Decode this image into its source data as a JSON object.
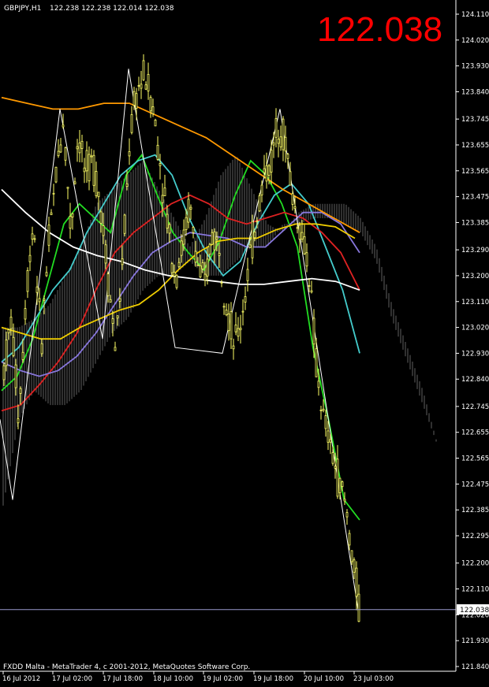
{
  "header": {
    "symbol_label": "GBPJPY,H1",
    "ohlc_label": "122.238 122.238 122.014 122.038",
    "big_price": "122.038"
  },
  "footer": {
    "copyright": "FXDD Malta - MetaTrader 4, c 2001-2012, MetaQuotes Software Corp."
  },
  "chart_data": {
    "type": "line",
    "symbol": "GBPJPY",
    "timeframe": "H1",
    "current_price": 122.038,
    "current_price_label": "122.038",
    "ylim": [
      121.84,
      124.11
    ],
    "y_ticks": [
      "124.110",
      "124.020",
      "123.930",
      "123.840",
      "123.745",
      "123.655",
      "123.565",
      "123.475",
      "123.385",
      "123.290",
      "123.200",
      "123.110",
      "123.020",
      "122.930",
      "122.840",
      "122.745",
      "122.655",
      "122.565",
      "122.475",
      "122.385",
      "122.295",
      "122.200",
      "122.110",
      "122.020",
      "121.930",
      "121.840"
    ],
    "x_ticks": [
      "16 Jul 2012",
      "17 Jul 02:00",
      "17 Jul 18:00",
      "18 Jul 10:00",
      "19 Jul 02:00",
      "19 Jul 18:00",
      "20 Jul 10:00",
      "23 Jul 03:00"
    ],
    "colors": {
      "background": "#000000",
      "axis": "#ffffff",
      "price": "#ffff66",
      "zigzag": "#ffffff",
      "ma_fast": "#22dd22",
      "ma_cyan": "#44cccc",
      "ma_red": "#dd2222",
      "ma_purple": "#8877dd",
      "ma_yellow": "#eecc00",
      "ma_orange": "#ff9900",
      "ma_white": "#ffffff",
      "current_line": "#9999cc",
      "big_price": "#ff0000"
    },
    "price_path": [
      122.88,
      123.05,
      122.7,
      123.15,
      123.4,
      122.95,
      123.3,
      123.55,
      123.75,
      123.35,
      123.7,
      123.55,
      123.6,
      123.45,
      123.2,
      122.95,
      123.25,
      123.7,
      123.85,
      123.9,
      123.8,
      123.6,
      123.4,
      123.2,
      123.3,
      123.45,
      123.25,
      123.15,
      123.35,
      123.3,
      123.1,
      122.95,
      123.05,
      123.25,
      123.4,
      123.55,
      123.6,
      123.75,
      123.65,
      123.45,
      123.35,
      123.25,
      122.9,
      122.7,
      122.6,
      122.5,
      122.4,
      122.2,
      122.02
    ],
    "zigzag": [
      [
        0,
        122.7
      ],
      [
        16,
        122.42
      ],
      [
        76,
        123.78
      ],
      [
        130,
        122.98
      ],
      [
        163,
        123.92
      ],
      [
        222,
        122.95
      ],
      [
        282,
        122.93
      ],
      [
        355,
        123.78
      ],
      [
        455,
        122.02
      ]
    ],
    "series": [
      {
        "name": "",
        "color_key": "ma_fast",
        "values": [
          122.8,
          122.85,
          122.98,
          123.18,
          123.38,
          123.45,
          123.4,
          123.35,
          123.55,
          123.62,
          123.48,
          123.35,
          123.28,
          123.22,
          123.32,
          123.48,
          123.6,
          123.55,
          123.45,
          123.3,
          122.95,
          122.7,
          122.42,
          122.35
        ]
      },
      {
        "name": "",
        "color_key": "ma_cyan",
        "values": [
          122.9,
          122.95,
          123.05,
          123.15,
          123.22,
          123.35,
          123.45,
          123.55,
          123.6,
          123.62,
          123.55,
          123.4,
          123.28,
          123.2,
          123.25,
          123.38,
          123.48,
          123.52,
          123.45,
          123.3,
          123.15,
          122.93
        ]
      },
      {
        "name": "",
        "color_key": "ma_red",
        "values": [
          122.73,
          122.75,
          122.82,
          122.9,
          123.0,
          123.15,
          123.28,
          123.35,
          123.4,
          123.45,
          123.48,
          123.45,
          123.4,
          123.38,
          123.4,
          123.42,
          123.4,
          123.35,
          123.28,
          123.15
        ]
      },
      {
        "name": "",
        "color_key": "ma_purple",
        "values": [
          122.9,
          122.87,
          122.85,
          122.87,
          122.92,
          123.0,
          123.1,
          123.2,
          123.28,
          123.32,
          123.35,
          123.34,
          123.33,
          123.3,
          123.3,
          123.36,
          123.42,
          123.42,
          123.38,
          123.28
        ]
      },
      {
        "name": "",
        "color_key": "ma_yellow",
        "values": [
          123.02,
          123.0,
          122.98,
          122.98,
          123.02,
          123.05,
          123.08,
          123.1,
          123.15,
          123.22,
          123.28,
          123.32,
          123.33,
          123.33,
          123.36,
          123.38,
          123.38,
          123.37,
          123.33
        ]
      },
      {
        "name": "",
        "color_key": "ma_orange",
        "values": [
          123.82,
          123.8,
          123.78,
          123.78,
          123.8,
          123.8,
          123.76,
          123.72,
          123.68,
          123.62,
          123.56,
          123.5,
          123.45,
          123.4,
          123.35
        ]
      },
      {
        "name": "",
        "color_key": "ma_white",
        "values": [
          123.5,
          123.42,
          123.35,
          123.3,
          123.27,
          123.25,
          123.22,
          123.2,
          123.19,
          123.18,
          123.17,
          123.17,
          123.18,
          123.19,
          123.18,
          123.15
        ]
      }
    ],
    "cloud_upper": [
      123.02,
      123.02,
      123.05,
      123.1,
      123.2,
      123.3,
      123.45,
      123.5,
      123.55,
      123.6,
      123.5,
      123.4,
      123.3,
      123.4,
      123.55,
      123.62,
      123.5,
      123.38,
      123.35,
      123.42,
      123.45,
      123.45,
      123.45,
      123.4,
      123.3,
      123.1,
      122.95,
      122.8,
      122.6
    ],
    "cloud_lower": [
      122.4,
      122.7,
      122.8,
      122.75,
      122.75,
      122.8,
      122.9,
      123.0,
      123.05,
      123.15,
      123.2,
      123.2,
      123.25,
      123.2,
      123.2,
      123.25,
      123.3,
      123.3,
      123.38,
      123.38,
      123.4,
      123.4,
      123.38,
      123.35,
      123.25,
      123.05,
      122.9,
      122.75,
      122.6
    ]
  }
}
